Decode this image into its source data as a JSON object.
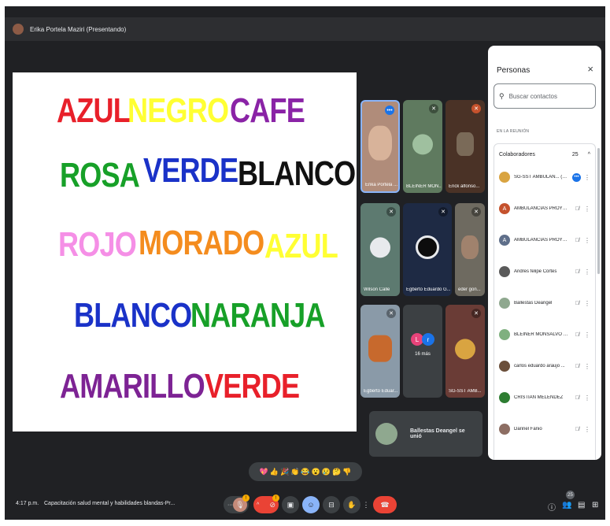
{
  "topbar": {
    "presenter": "Erika Portela Maziri (Presentando)"
  },
  "slide": {
    "words": [
      {
        "text": "AZUL",
        "color": "#e8202a"
      },
      {
        "text": "NEGRO",
        "color": "#ffff33"
      },
      {
        "text": "CAFE",
        "color": "#8a23a6"
      },
      {
        "text": "ROSA",
        "color": "#17a028"
      },
      {
        "text": "VERDE",
        "color": "#1a32c8"
      },
      {
        "text": "BLANCO",
        "color": "#111111"
      },
      {
        "text": "ROJO",
        "color": "#f58fe6"
      },
      {
        "text": "MORADO",
        "color": "#f48c1e"
      },
      {
        "text": "AZUL",
        "color": "#ffff33"
      },
      {
        "text": "BLANCO",
        "color": "#1a32c8"
      },
      {
        "text": "NARANJA",
        "color": "#17a028"
      },
      {
        "text": "AMARILLO",
        "color": "#7d2394"
      },
      {
        "text": "VERDE",
        "color": "#e8202a"
      }
    ]
  },
  "tiles": [
    {
      "name": "Erika Portela ..."
    },
    {
      "name": "BLEINER MON..."
    },
    {
      "name": "Erick alfonso..."
    },
    {
      "name": "Wilson Calle"
    },
    {
      "name": "Egberto Eduardo G..."
    },
    {
      "name": "eder gon..."
    },
    {
      "name": "Egberto Eduar..."
    },
    {
      "name": "SG-SST AMB..."
    }
  ],
  "more_tile": {
    "label": "16 más",
    "initials": [
      "L",
      "r"
    ]
  },
  "toast": {
    "message": "Ballestas Deangel se unió"
  },
  "panel": {
    "title": "Personas",
    "close_icon": "×",
    "search_placeholder": "Buscar contactos",
    "section": "EN LA REUNIÓN",
    "group_label": "Colaboradores",
    "group_count": "25",
    "people": [
      {
        "name": "SG-SST AMBULAN... (Tú)",
        "initial": "",
        "color": "#d9a441"
      },
      {
        "name": "AMBULANCIAS PROYE...",
        "initial": "A",
        "color": "#c5522d"
      },
      {
        "name": "AMBULANCIAS PROYE...",
        "initial": "A",
        "color": "#5f6f8a"
      },
      {
        "name": "Andres felipe Cortes",
        "initial": "",
        "color": "#5a5a5a"
      },
      {
        "name": "Ballestas Deangel",
        "initial": "",
        "color": "#8fa88f"
      },
      {
        "name": "BLEINER MONSALVO BA...",
        "initial": "",
        "color": "#7fb07f"
      },
      {
        "name": "carlos eduardo araujo ...",
        "initial": "",
        "color": "#6b4f3a"
      },
      {
        "name": "CRISTIAN MELENDEZ",
        "initial": "",
        "color": "#2e7d32"
      },
      {
        "name": "Darinel Fanio",
        "initial": "",
        "color": "#8d6e63"
      }
    ]
  },
  "reactions": [
    "💖",
    "👍",
    "🎉",
    "👏",
    "😂",
    "😮",
    "😢",
    "🤔",
    "👎"
  ],
  "bottombar": {
    "time": "4:17 p.m.",
    "meeting_name": "Capacitación salud mental y habilidades blandas-Pr...",
    "mic_badge": "!",
    "cam_badge": "!",
    "people_count": "25"
  }
}
